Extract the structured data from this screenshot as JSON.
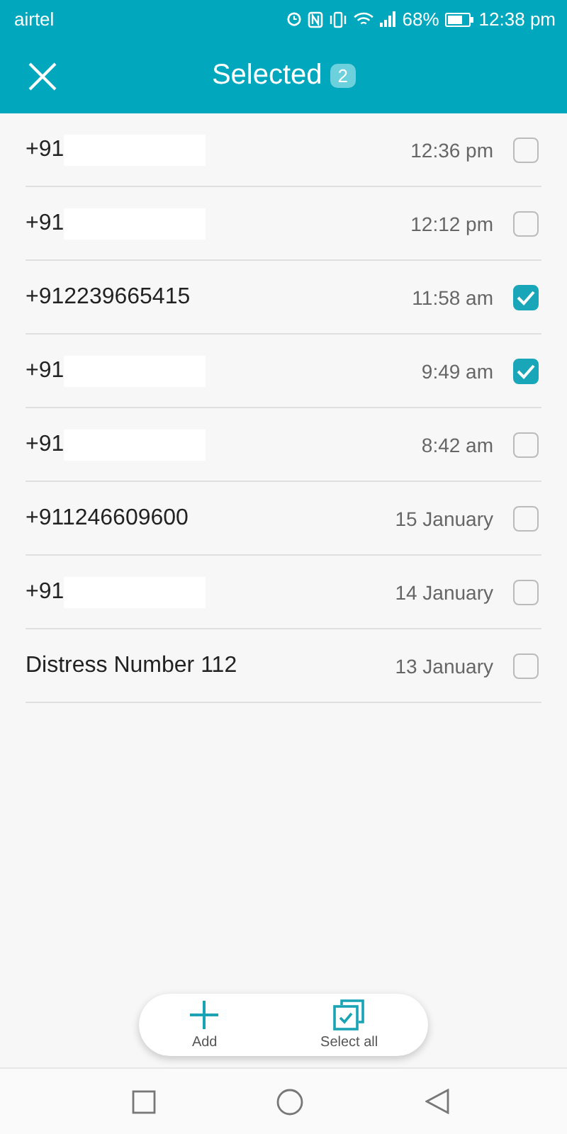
{
  "status_bar": {
    "carrier": "airtel",
    "battery": "68%",
    "time": "12:38 pm"
  },
  "header": {
    "title": "Selected",
    "count": "2"
  },
  "contacts": [
    {
      "name": "+91",
      "redacted": true,
      "time": "12:36 pm",
      "selected": false
    },
    {
      "name": "+91",
      "redacted": true,
      "time": "12:12 pm",
      "selected": false
    },
    {
      "name": "+912239665415",
      "redacted": false,
      "time": "11:58 am",
      "selected": true
    },
    {
      "name": "+91",
      "redacted": true,
      "time": "9:49 am",
      "selected": true
    },
    {
      "name": "+91",
      "redacted": true,
      "time": "8:42 am",
      "selected": false
    },
    {
      "name": "+911246609600",
      "redacted": false,
      "time": "15 January",
      "selected": false
    },
    {
      "name": "+91",
      "redacted": true,
      "time": "14 January",
      "selected": false
    },
    {
      "name": "Distress Number 112",
      "redacted": false,
      "time": "13 January",
      "selected": false
    }
  ],
  "actions": [
    {
      "kind": "add",
      "label": "Add"
    },
    {
      "kind": "select_all",
      "label": "Select all"
    }
  ]
}
